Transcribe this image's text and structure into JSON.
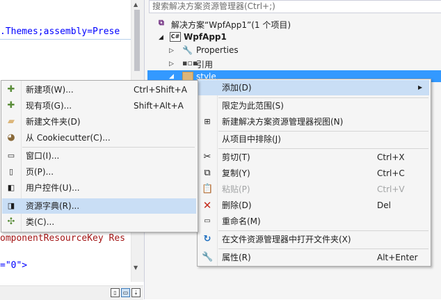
{
  "editor": {
    "line1": ".Themes;assembly=Prese",
    "line2": "omponentResourceKey Res",
    "line3": "=\"0\">"
  },
  "explorer": {
    "search_placeholder": "搜索解决方案资源管理器(Ctrl+;)",
    "solution": "解决方案“WpfApp1”(1 个项目)",
    "project": "WpfApp1",
    "properties": "Properties",
    "references": "引用",
    "folder": "style"
  },
  "context_menu": {
    "add": "添加(D)",
    "scope": "限定为此范围(S)",
    "new_view": "新建解决方案资源管理器视图(N)",
    "exclude": "从项目中排除(J)",
    "cut": "剪切(T)",
    "cut_sc": "Ctrl+X",
    "copy": "复制(Y)",
    "copy_sc": "Ctrl+C",
    "paste": "粘贴(P)",
    "paste_sc": "Ctrl+V",
    "delete": "删除(D)",
    "delete_sc": "Del",
    "rename": "重命名(M)",
    "open_folder": "在文件资源管理器中打开文件夹(X)",
    "properties": "属性(R)",
    "properties_sc": "Alt+Enter"
  },
  "add_submenu": {
    "new_item": "新建项(W)...",
    "new_item_sc": "Ctrl+Shift+A",
    "existing_item": "现有项(G)...",
    "existing_item_sc": "Shift+Alt+A",
    "new_folder": "新建文件夹(D)",
    "cookiecutter": "从 Cookiecutter(C)...",
    "window": "窗口(I)...",
    "page": "页(P)...",
    "user_control": "用户控件(U)...",
    "resource_dictionary": "资源字典(R)...",
    "class": "类(C)..."
  }
}
